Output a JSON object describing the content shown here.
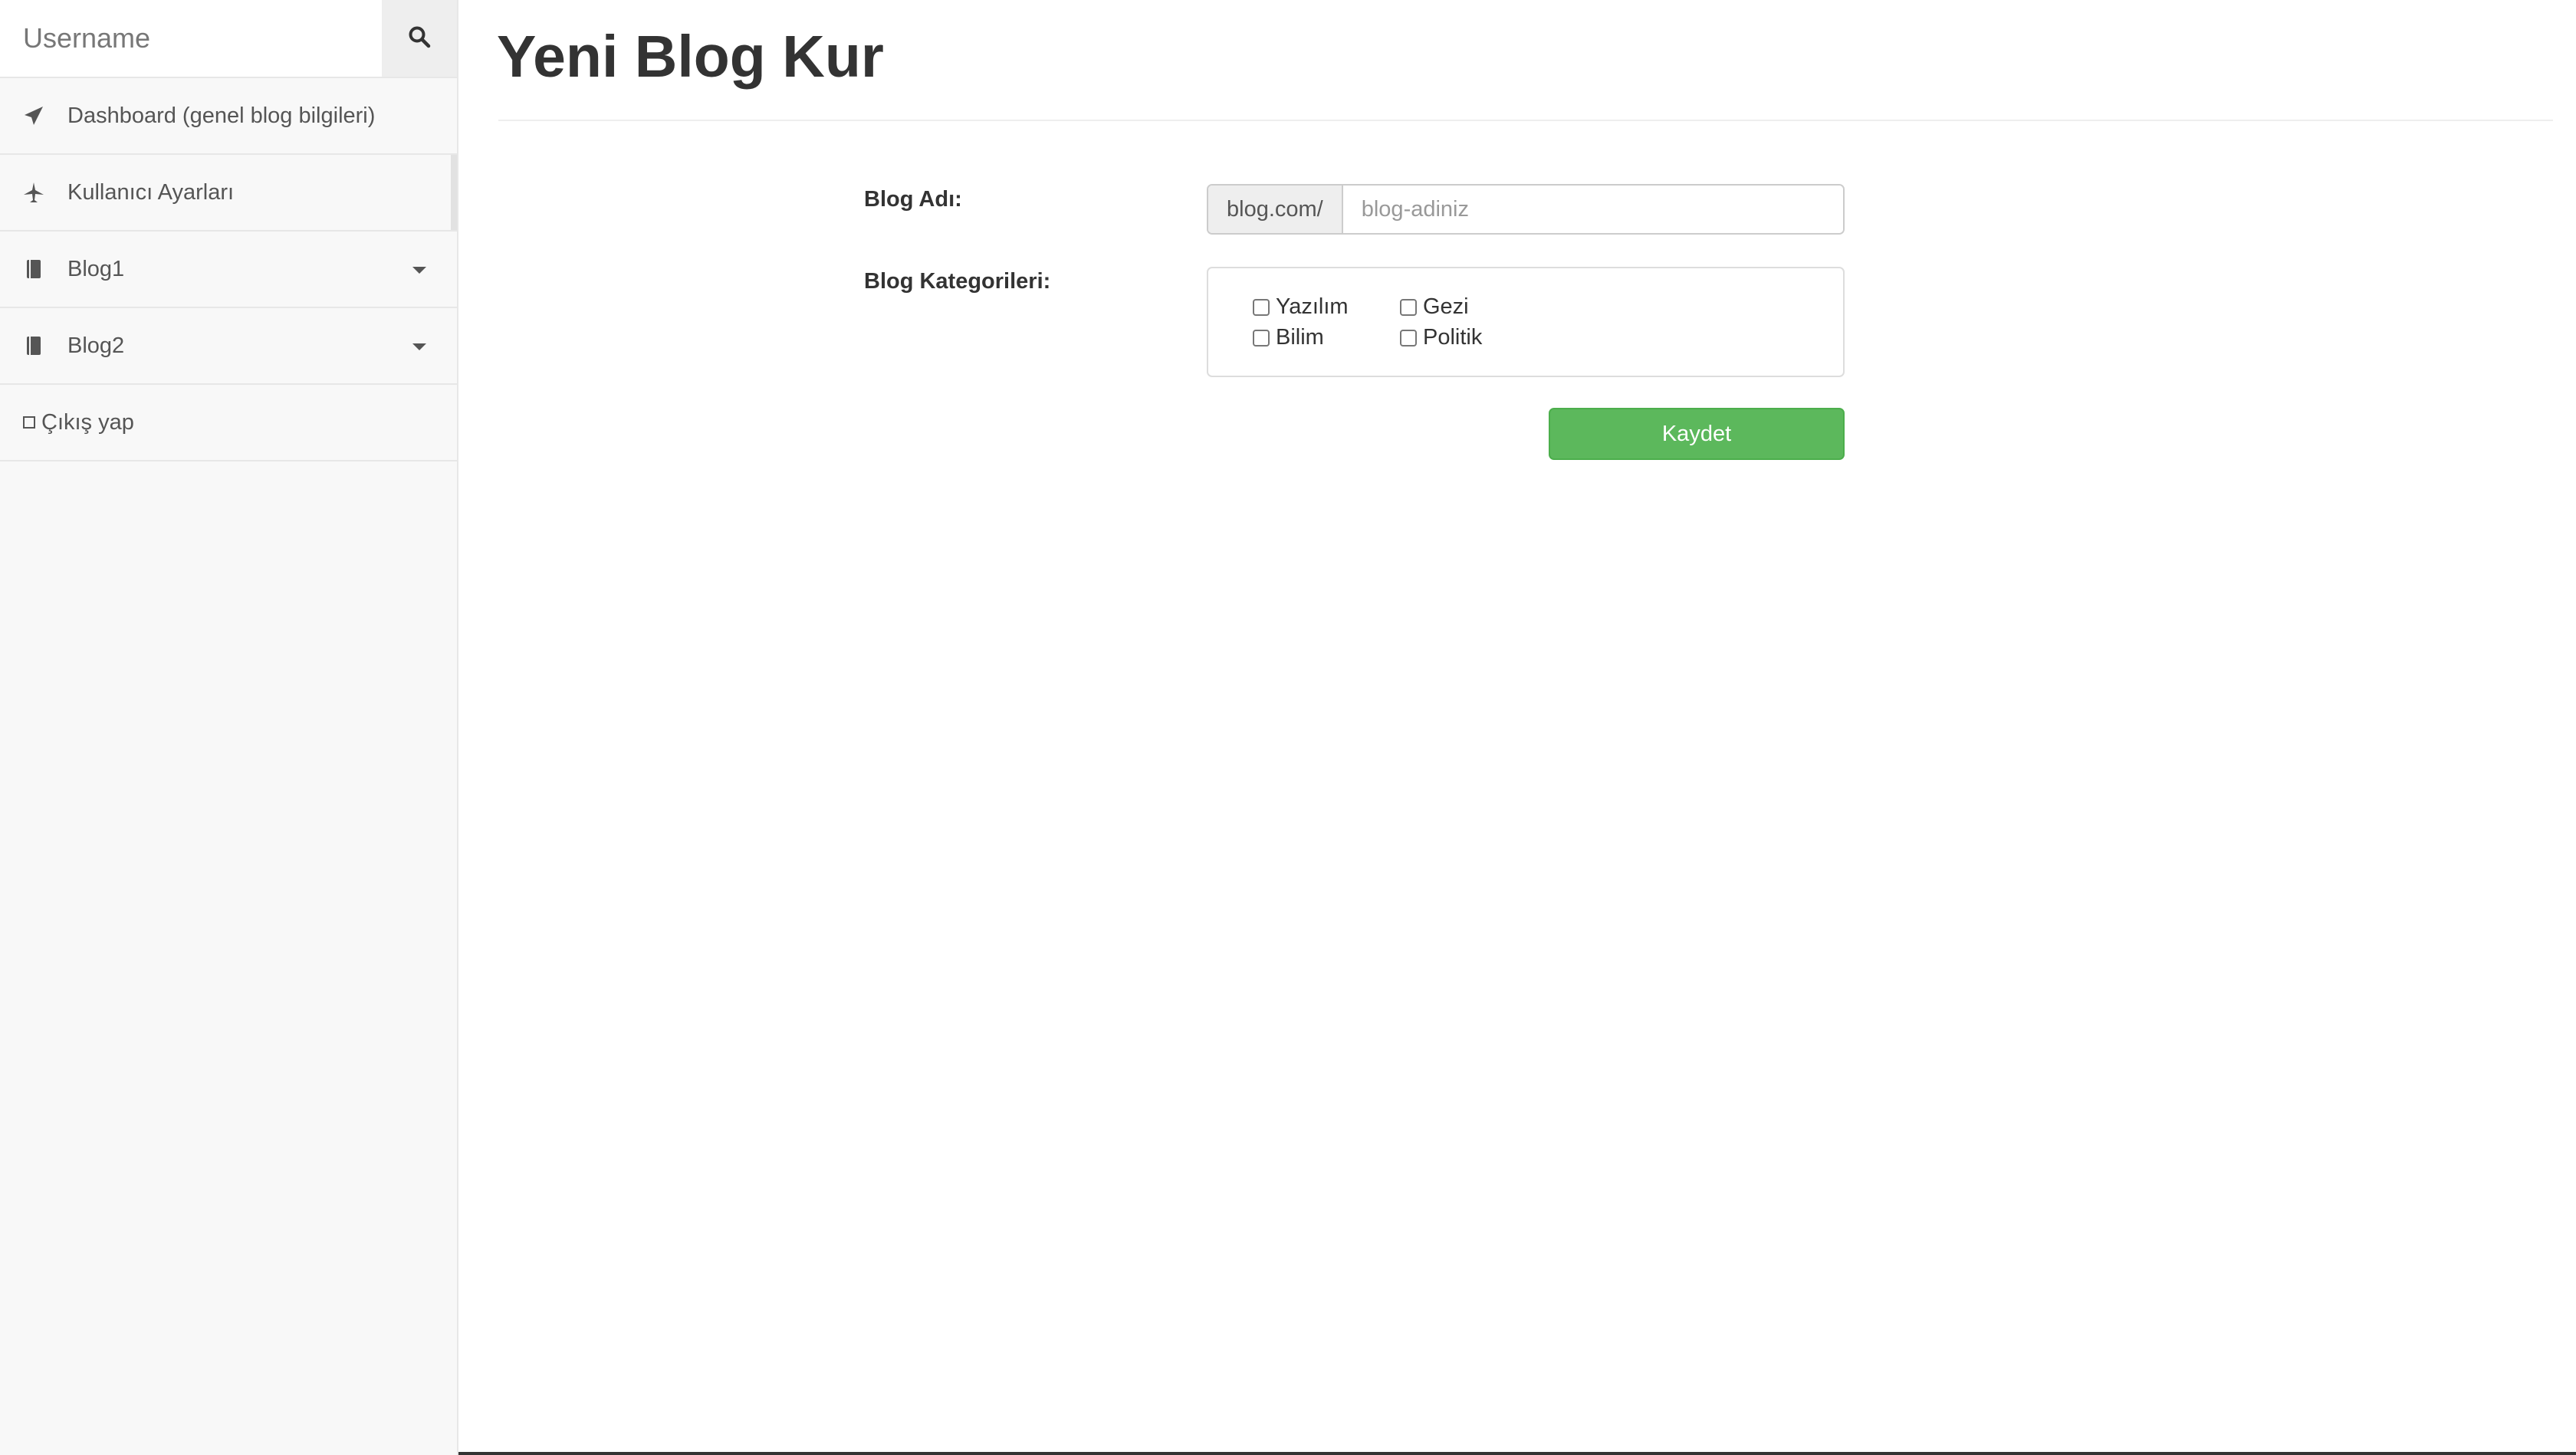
{
  "sidebar": {
    "search": {
      "placeholder": "Username",
      "icon": "search-icon"
    },
    "items": [
      {
        "label": "Dashboard (genel blog bilgileri)",
        "icon": "paper-plane-icon"
      },
      {
        "label": "Kullanıcı Ayarları",
        "icon": "plane-icon",
        "active": true
      },
      {
        "label": "Blog1",
        "icon": "book-icon",
        "dropdown": true
      },
      {
        "label": "Blog2",
        "icon": "book-icon",
        "dropdown": true
      },
      {
        "label": "Çıkış yap",
        "icon": "checkbox-unchecked-icon"
      }
    ]
  },
  "main": {
    "title": "Yeni Blog Kur",
    "form": {
      "blog_name_label": "Blog Adı:",
      "url_prefix": "blog.com/",
      "blog_name_placeholder": "blog-adiniz",
      "categories_label": "Blog Kategorileri:",
      "categories": [
        "Yazılım",
        "Gezi",
        "Bilim",
        "Politik"
      ],
      "save_label": "Kaydet"
    }
  },
  "colors": {
    "sidebar_bg": "#f8f8f8",
    "save_button": "#5cb85c",
    "text": "#333333"
  }
}
